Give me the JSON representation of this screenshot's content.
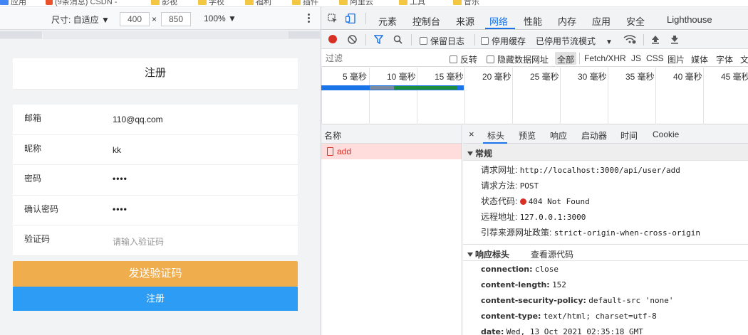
{
  "bookmarks": [
    "应用",
    "(9条消息) CSDN -",
    "影视",
    "学校",
    "福利",
    "插件",
    "阿里云",
    "工具",
    "音乐"
  ],
  "device_toolbar": {
    "size_label": "尺寸: 自适应 ▼",
    "width": "400",
    "times": "×",
    "height": "850",
    "zoom": "100% ▼"
  },
  "register_form": {
    "title": "注册",
    "fields": [
      {
        "label": "邮箱",
        "value": "110@qq.com"
      },
      {
        "label": "昵称",
        "value": "kk"
      },
      {
        "label": "密码",
        "value": "••••"
      },
      {
        "label": "确认密码",
        "value": "••••"
      },
      {
        "label": "验证码",
        "placeholder": "请输入验证码"
      }
    ],
    "send_code": "发送验证码",
    "submit": "注册"
  },
  "devtools": {
    "tabs": [
      "元素",
      "控制台",
      "来源",
      "网络",
      "性能",
      "内存",
      "应用",
      "安全",
      "Lighthouse"
    ],
    "active_tab": "网络",
    "toolbar": {
      "preserve_log": "保留日志",
      "disable_cache": "停用缓存",
      "throttle": "已停用节流模式"
    },
    "filter": {
      "placeholder": "过滤",
      "invert": "反转",
      "hide_data_urls": "隐藏数据网址",
      "types": [
        "全部",
        "Fetch/XHR",
        "JS",
        "CSS",
        "图片",
        "媒体",
        "字体",
        "文"
      ]
    },
    "timeline_ticks": [
      "5 毫秒",
      "10 毫秒",
      "15 毫秒",
      "20 毫秒",
      "25 毫秒",
      "30 毫秒",
      "35 毫秒",
      "40 毫秒",
      "45 毫秒"
    ],
    "request_list": {
      "header": "名称",
      "requests": [
        {
          "name": "add",
          "status": "error"
        }
      ]
    },
    "detail_tabs": [
      "标头",
      "预览",
      "响应",
      "启动器",
      "时间",
      "Cookie"
    ],
    "general": {
      "title": "常规",
      "rows": [
        {
          "key": "请求网址:",
          "value": "http://localhost:3000/api/user/add"
        },
        {
          "key": "请求方法:",
          "value": "POST"
        },
        {
          "key": "状态代码:",
          "value": "404 Not Found"
        },
        {
          "key": "远程地址:",
          "value": "127.0.0.1:3000"
        },
        {
          "key": "引荐来源网址政策:",
          "value": "strict-origin-when-cross-origin"
        }
      ]
    },
    "response_headers": {
      "title": "响应标头",
      "view_source": "查看源代码",
      "rows": [
        {
          "key": "connection:",
          "value": "close"
        },
        {
          "key": "content-length:",
          "value": "152"
        },
        {
          "key": "content-security-policy:",
          "value": "default-src 'none'"
        },
        {
          "key": "content-type:",
          "value": "text/html; charset=utf-8"
        },
        {
          "key": "date:",
          "value": "Wed, 13 Oct 2021 02:35:18 GMT"
        }
      ]
    },
    "colors": {
      "accent": "#1a73e8",
      "error": "#d93025",
      "send_btn": "#f0ad4e",
      "submit_btn": "#2d9cf5"
    }
  }
}
